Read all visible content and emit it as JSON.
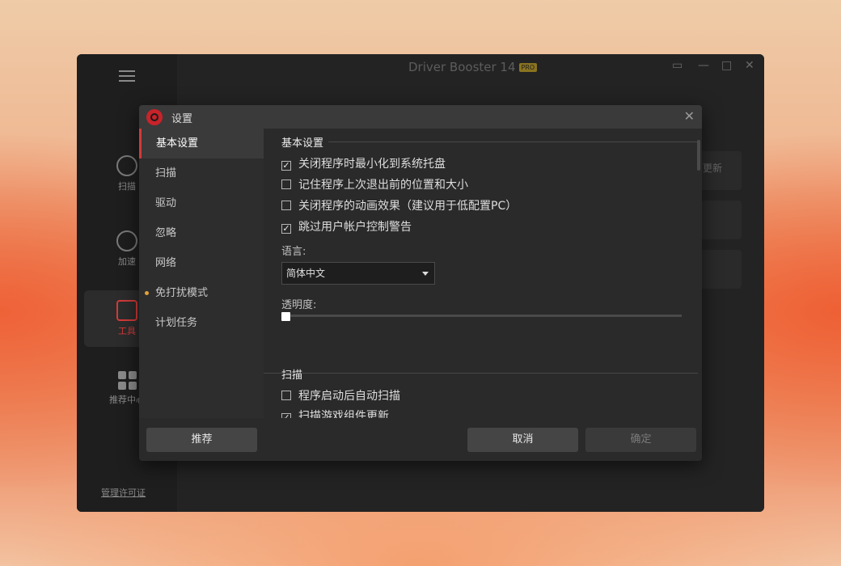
{
  "app": {
    "title": "Driver Booster 14",
    "pro_badge": "PRO",
    "nav": [
      {
        "label": "扫描"
      },
      {
        "label": "加速"
      },
      {
        "label": "工具"
      },
      {
        "label": "推荐中心"
      }
    ],
    "license_link": "管理许可证",
    "card_text": "更新"
  },
  "dialog": {
    "title": "设置",
    "sidebar": [
      {
        "label": "基本设置"
      },
      {
        "label": "扫描"
      },
      {
        "label": "驱动"
      },
      {
        "label": "忽略"
      },
      {
        "label": "网络"
      },
      {
        "label": "免打扰模式"
      },
      {
        "label": "计划任务"
      }
    ],
    "basic": {
      "heading": "基本设置",
      "options": [
        {
          "label": "关闭程序时最小化到系统托盘",
          "checked": true
        },
        {
          "label": "记住程序上次退出前的位置和大小",
          "checked": false
        },
        {
          "label": "关闭程序的动画效果（建议用于低配置PC）",
          "checked": false
        },
        {
          "label": "跳过用户帐户控制警告",
          "checked": true
        }
      ],
      "language_label": "语言:",
      "language_value": "简体中文",
      "opacity_label": "透明度:",
      "opacity_level": 0
    },
    "scan": {
      "heading": "扫描",
      "options": [
        {
          "label": "程序启动后自动扫描",
          "checked": false
        },
        {
          "label": "扫描游戏组件更新",
          "checked": true
        }
      ]
    },
    "buttons": {
      "recommend": "推荐",
      "cancel": "取消",
      "confirm": "确定"
    }
  }
}
